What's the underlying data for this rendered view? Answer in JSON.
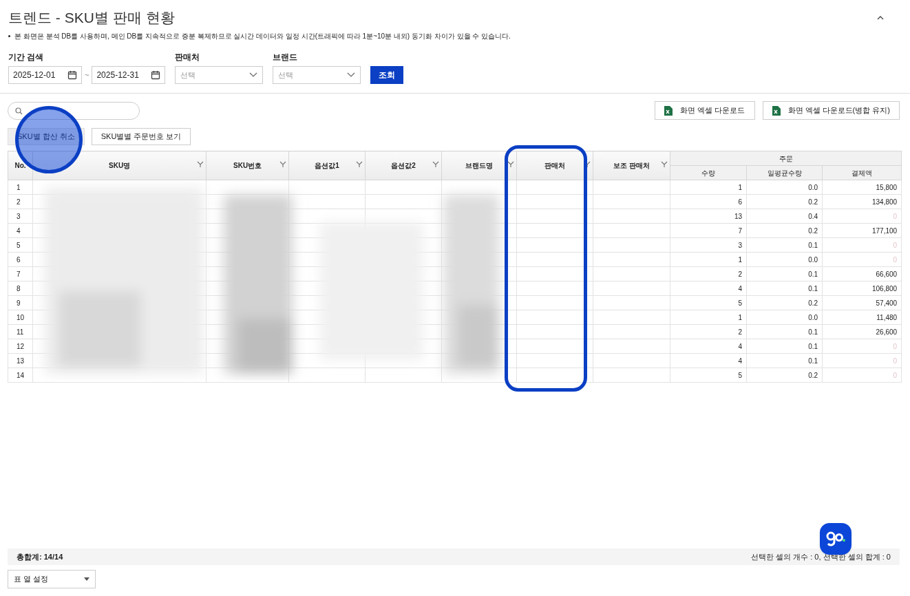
{
  "page_title": "트렌드 - SKU별 판매 현황",
  "notice": "본 화면은 분석 DB를 사용하며, 메인 DB를 지속적으로 증분 복제하므로 실시간 데이터와 일정 시간(트래픽에 따라 1분~10분 내외) 동기화 차이가 있을 수 있습니다.",
  "filters": {
    "period_label": "기간 검색",
    "start_date": "2025-12-01",
    "separator": "~",
    "end_date": "2025-12-31",
    "seller_label": "판매처",
    "seller_placeholder": "선택",
    "brand_label": "브랜드",
    "brand_placeholder": "선택",
    "search_button": "조회"
  },
  "downloads": [
    "화면 엑셀 다운로드",
    "화면 엑셀 다운로드(병합 유지)"
  ],
  "toggles": [
    {
      "label": "SKU별 합산 취소",
      "selected": true
    },
    {
      "label": "SKU별별 주문번호 보기",
      "selected": false
    }
  ],
  "table": {
    "columns": [
      {
        "label": "No.",
        "filter": false
      },
      {
        "label": "SKU명",
        "filter": true
      },
      {
        "label": "SKU번호",
        "filter": true
      },
      {
        "label": "옵션값1",
        "filter": true
      },
      {
        "label": "옵션값2",
        "filter": true
      },
      {
        "label": "브랜드명",
        "filter": true
      },
      {
        "label": "판매처",
        "filter": true
      },
      {
        "label": "보조 판매처",
        "filter": true
      }
    ],
    "group": {
      "label": "주문",
      "columns": [
        "수량",
        "일평균수량",
        "결제액"
      ]
    },
    "rows": [
      {
        "no": "1",
        "qty": "1",
        "avg": "0.0",
        "amount": {
          "text": "15,800",
          "dimmed": false
        }
      },
      {
        "no": "2",
        "qty": "6",
        "avg": "0.2",
        "amount": {
          "text": "134,800",
          "dimmed": false
        }
      },
      {
        "no": "3",
        "qty": "13",
        "avg": "0.4",
        "amount": {
          "text": "0",
          "dimmed": true
        }
      },
      {
        "no": "4",
        "qty": "7",
        "avg": "0.2",
        "amount": {
          "text": "177,100",
          "dimmed": false
        }
      },
      {
        "no": "5",
        "qty": "3",
        "avg": "0.1",
        "amount": {
          "text": "0",
          "dimmed": true
        }
      },
      {
        "no": "6",
        "qty": "1",
        "avg": "0.0",
        "amount": {
          "text": "0",
          "dimmed": true
        }
      },
      {
        "no": "7",
        "qty": "2",
        "avg": "0.1",
        "amount": {
          "text": "66,600",
          "dimmed": false
        }
      },
      {
        "no": "8",
        "qty": "4",
        "avg": "0.1",
        "amount": {
          "text": "106,800",
          "dimmed": false
        }
      },
      {
        "no": "9",
        "qty": "5",
        "avg": "0.2",
        "amount": {
          "text": "57,400",
          "dimmed": false
        }
      },
      {
        "no": "10",
        "qty": "1",
        "avg": "0.0",
        "amount": {
          "text": "11,480",
          "dimmed": false
        }
      },
      {
        "no": "11",
        "qty": "2",
        "avg": "0.1",
        "amount": {
          "text": "26,600",
          "dimmed": false
        }
      },
      {
        "no": "12",
        "qty": "4",
        "avg": "0.1",
        "amount": {
          "text": "0",
          "dimmed": true
        }
      },
      {
        "no": "13",
        "qty": "4",
        "avg": "0.1",
        "amount": {
          "text": "0",
          "dimmed": true
        }
      },
      {
        "no": "14",
        "qty": "5",
        "avg": "0.2",
        "amount": {
          "text": "0",
          "dimmed": true
        }
      }
    ]
  },
  "summary": {
    "total": "총합계: 14/14",
    "selection": "선택한 셀의 개수 : 0, 선택한 셀의 합계 : 0"
  },
  "column_settings": "표 열 설정"
}
